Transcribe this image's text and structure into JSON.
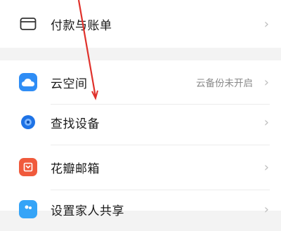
{
  "payment": {
    "label": "付款与账单",
    "icon": "card-icon"
  },
  "settings_items": [
    {
      "label": "云空间",
      "value": "云备份未开启",
      "icon": "cloud-icon",
      "color": "#2f8df5"
    },
    {
      "label": "查找设备",
      "value": "",
      "icon": "find-device-icon",
      "color": "#1e73e6"
    },
    {
      "label": "花瓣邮箱",
      "value": "",
      "icon": "mail-icon",
      "color": "#f05a3c"
    },
    {
      "label": "设置家人共享",
      "value": "",
      "icon": "family-icon",
      "color": "#35a4f7"
    }
  ],
  "chevron": "›",
  "colors": {
    "annotation_arrow": "#e0312b"
  }
}
